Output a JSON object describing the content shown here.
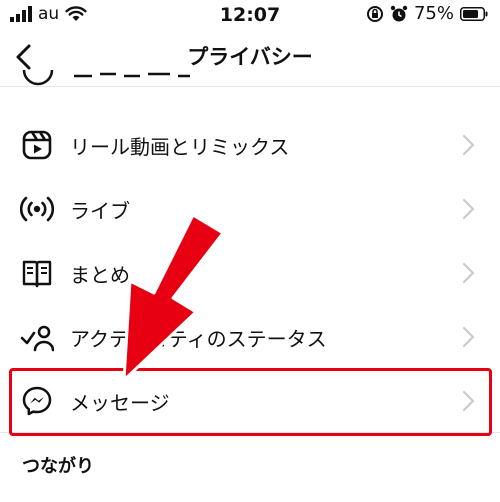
{
  "status_bar": {
    "carrier": "au",
    "time": "12:07",
    "battery_percent": "75%",
    "icons": [
      "signal-bars-icon",
      "wifi-icon",
      "orientation-lock-icon",
      "alarm-icon",
      "battery-icon"
    ]
  },
  "nav": {
    "back_icon": "chevron-left-icon",
    "title": "プライバシー"
  },
  "rows": [
    {
      "label": "リール動画とリミックス",
      "icon": "reels-icon"
    },
    {
      "label": "ライブ",
      "icon": "live-icon"
    },
    {
      "label": "まとめ",
      "icon": "guides-icon"
    },
    {
      "label": "アクティビティのステータス",
      "icon": "activity-status-icon"
    },
    {
      "label": "メッセージ",
      "icon": "messenger-icon",
      "highlighted": true
    }
  ],
  "section_header": "つながり",
  "colors": {
    "accent_red": "#e60012",
    "text": "#111111",
    "chevron": "#c7c7cc",
    "divider": "#e6e6e6"
  }
}
